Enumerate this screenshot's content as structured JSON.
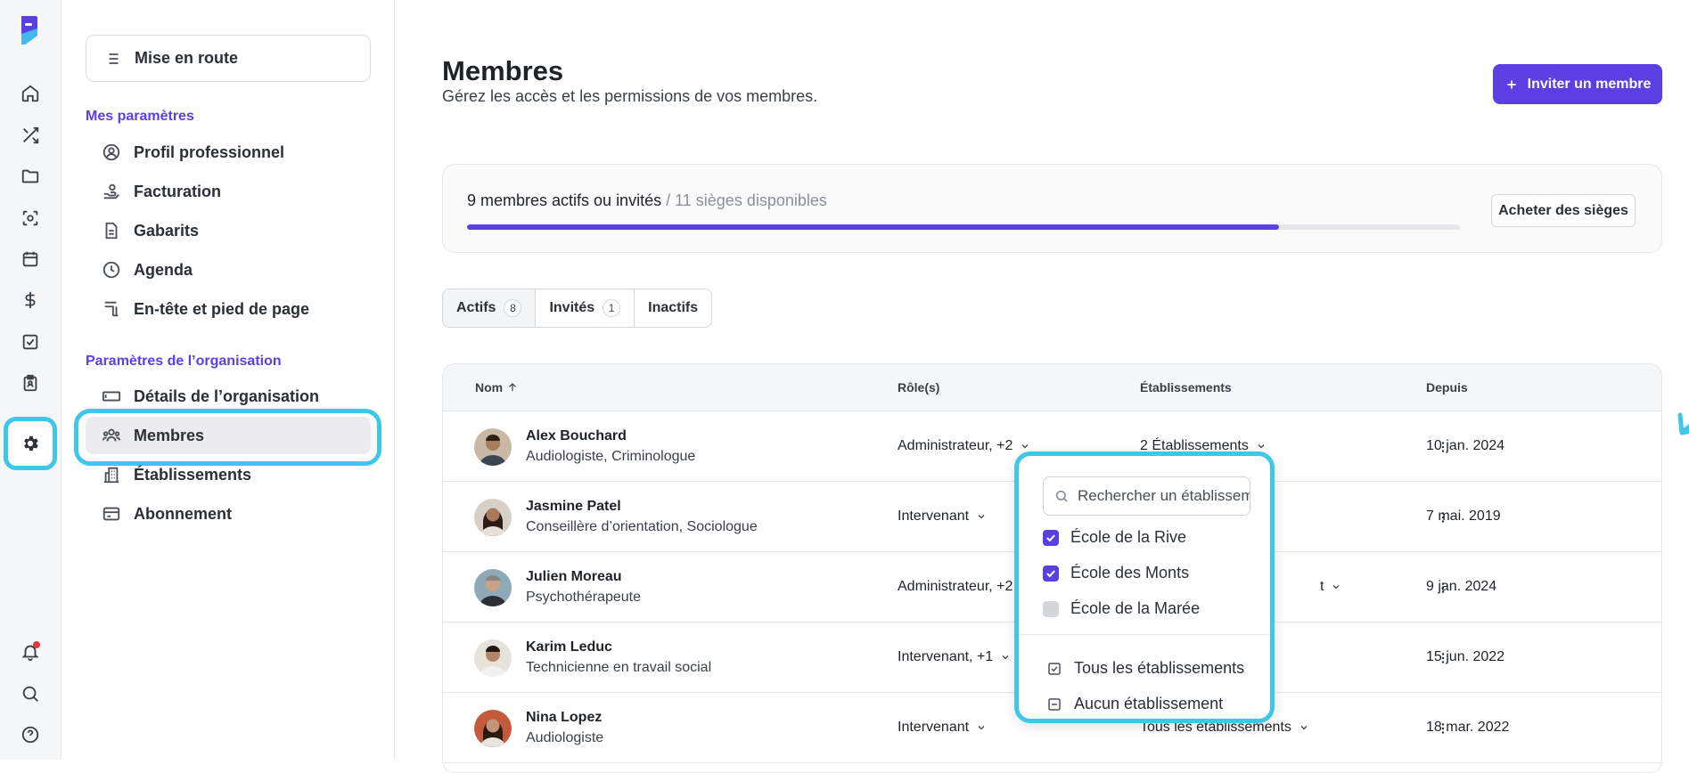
{
  "rail": {
    "icons": [
      "logo",
      "home-icon",
      "shuffle-icon",
      "folder-icon",
      "scan-icon",
      "calendar-icon",
      "dollar-icon",
      "task-icon",
      "clipboard-icon",
      "gear-icon",
      "bell-icon",
      "search-icon",
      "help-icon"
    ]
  },
  "sidebar": {
    "onboarding_label": "Mise en route",
    "my_settings_title": "Mes paramètres",
    "my_settings": [
      {
        "label": "Profil professionnel",
        "icon": "user-circle-icon"
      },
      {
        "label": "Facturation",
        "icon": "billing-hand-icon"
      },
      {
        "label": "Gabarits",
        "icon": "document-icon"
      },
      {
        "label": "Agenda",
        "icon": "clock-icon"
      },
      {
        "label": "En-tête et pied de page",
        "icon": "header-footer-icon"
      }
    ],
    "org_settings_title": "Paramètres de l’organisation",
    "org_settings": [
      {
        "label": "Détails de l’organisation",
        "icon": "card-icon"
      },
      {
        "label": "Membres",
        "icon": "users-icon",
        "active": true
      },
      {
        "label": "Établissements",
        "icon": "building-icon"
      },
      {
        "label": "Abonnement",
        "icon": "credit-card-icon"
      }
    ]
  },
  "header": {
    "title": "Membres",
    "subtitle": "Gérez les accès et les permissions de vos membres.",
    "invite_label": "Inviter un membre"
  },
  "seats": {
    "count_text": "9 membres actifs ou invités",
    "available_text": " / 11 sièges disponibles",
    "progress_fraction": 0.818,
    "buy_label": "Acheter des sièges"
  },
  "tabs": [
    {
      "label": "Actifs",
      "count": "8",
      "active": true
    },
    {
      "label": "Invités",
      "count": "1",
      "active": false
    },
    {
      "label": "Inactifs",
      "count": "",
      "active": false
    }
  ],
  "table": {
    "headers": {
      "name": "Nom",
      "roles": "Rôle(s)",
      "establishments": "Établissements",
      "since": "Depuis"
    },
    "rows": [
      {
        "name": "Alex Bouchard",
        "title": "Audiologiste, Criminologue",
        "role": "Administrateur, +2",
        "establishments": "2 Établissements",
        "since": "10 jan. 2024"
      },
      {
        "name": "Jasmine Patel",
        "title": "Conseillère d’orientation, Sociologue",
        "role": "Intervenant",
        "establishments": "",
        "since": "7 mai. 2019"
      },
      {
        "name": "Julien Moreau",
        "title": "Psychothérapeute",
        "role": "Administrateur, +2",
        "establishments": "t",
        "since": "9 jan. 2024"
      },
      {
        "name": "Karim Leduc",
        "title": "Technicienne en travail social",
        "role": "Intervenant, +1",
        "establishments": "",
        "since": "15 jun. 2022"
      },
      {
        "name": "Nina Lopez",
        "title": "Audiologiste",
        "role": "Intervenant",
        "establishments": "Tous les établissements",
        "since": "18 mar. 2022"
      }
    ]
  },
  "dropdown": {
    "search_placeholder": "Rechercher un établissement",
    "options": [
      {
        "label": "École de la Rive",
        "checked": true
      },
      {
        "label": "École des Monts",
        "checked": true
      },
      {
        "label": "École de la Marée",
        "checked": false
      }
    ],
    "select_all": "Tous les établissements",
    "select_none": "Aucun établissement"
  },
  "colors": {
    "accent": "#5b3fe4",
    "highlight": "#3fc7ea"
  }
}
